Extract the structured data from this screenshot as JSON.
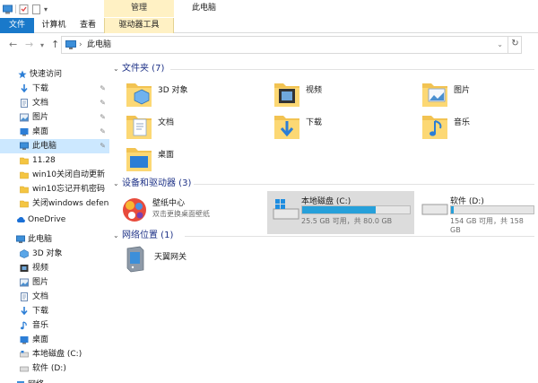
{
  "window": {
    "title": "此电脑",
    "context_tab": "管理"
  },
  "ribbon": {
    "tabs": [
      "文件",
      "计算机",
      "查看",
      "驱动器工具"
    ]
  },
  "address": {
    "path": "此电脑"
  },
  "sidebar": {
    "quick_access": "快速访问",
    "quick_items": [
      "下载",
      "文档",
      "图片",
      "桌面",
      "此电脑",
      "11.28",
      "win10关闭自动更新",
      "win10忘记开机密码",
      "关闭windows defender"
    ],
    "onedrive": "OneDrive",
    "this_pc": "此电脑",
    "pc_items": [
      "3D 对象",
      "视频",
      "图片",
      "文档",
      "下载",
      "音乐",
      "桌面",
      "本地磁盘 (C:)",
      "软件 (D:)"
    ],
    "network": "网络"
  },
  "main": {
    "folders_header": "文件夹 (7)",
    "folders": [
      "3D 对象",
      "视频",
      "图片",
      "文档",
      "下载",
      "音乐",
      "桌面"
    ],
    "devices_header": "设备和驱动器 (3)",
    "app": {
      "name": "壁纸中心",
      "desc": "双击更换桌面壁纸"
    },
    "drives": [
      {
        "name": "本地磁盘 (C:)",
        "size": "25.5 GB 可用，共 80.0 GB",
        "used_fraction": 0.68
      },
      {
        "name": "软件 (D:)",
        "size": "154 GB 可用，共 158 GB",
        "used_fraction": 0.03
      }
    ],
    "network_header": "网络位置 (1)",
    "network_items": [
      "天翼网关"
    ]
  },
  "colors": {
    "accent": "#1979ca",
    "manage_tab": "#fff1c4",
    "selection": "#cce8ff",
    "header_text": "#1e3287",
    "drive_fill": "#26a0da"
  }
}
